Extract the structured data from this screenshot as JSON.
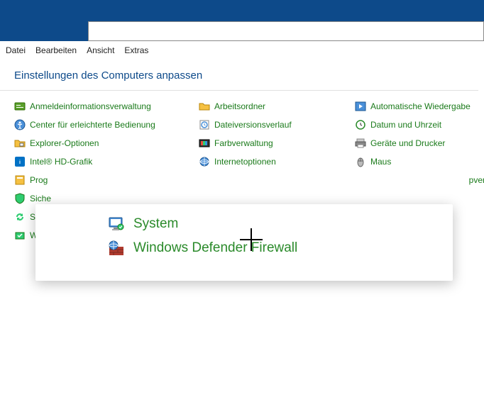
{
  "menubar": {
    "file": "Datei",
    "edit": "Bearbeiten",
    "view": "Ansicht",
    "extras": "Extras"
  },
  "heading": "Einstellungen des Computers anpassen",
  "items": {
    "r0c0": "Anmeldeinformationsverwaltung",
    "r0c1": "Arbeitsordner",
    "r0c2": "Automatische Wiedergabe",
    "r1c0": "Center für erleichterte Bedienung",
    "r1c1": "Dateiversionsverlauf",
    "r1c2": "Datum und Uhrzeit",
    "r2c0": "Explorer-Optionen",
    "r2c1": "Farbverwaltung",
    "r2c2": "Geräte und Drucker",
    "r3c0": "Intel® HD-Grafik",
    "r3c1": "Internetoptionen",
    "r3c2": "Maus",
    "r4c0": "Prog",
    "r4c2": "pverbin",
    "r5c0": "Siche",
    "r6c0": "Sync",
    "r7c0": "Wied"
  },
  "tooltip": {
    "row1": "System",
    "row2": "Windows Defender Firewall"
  }
}
